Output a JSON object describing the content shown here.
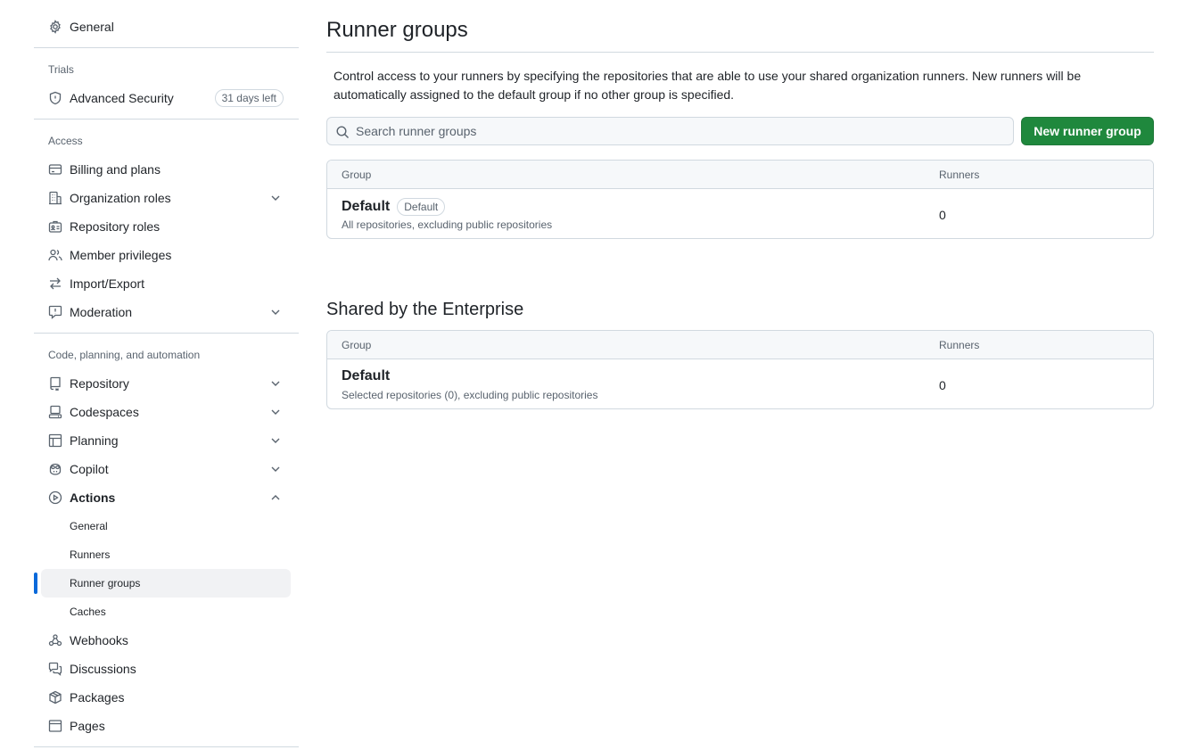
{
  "sidebar": {
    "general": "General",
    "trials_label": "Trials",
    "advanced_security": "Advanced Security",
    "trial_badge": "31 days left",
    "access_label": "Access",
    "access_items": [
      {
        "label": "Billing and plans",
        "icon": "credit-card-icon"
      },
      {
        "label": "Organization roles",
        "icon": "organization-icon",
        "expandable": true
      },
      {
        "label": "Repository roles",
        "icon": "id-badge-icon"
      },
      {
        "label": "Member privileges",
        "icon": "people-icon"
      },
      {
        "label": "Import/Export",
        "icon": "arrow-switch-icon"
      },
      {
        "label": "Moderation",
        "icon": "report-icon",
        "expandable": true
      }
    ],
    "code_label": "Code, planning, and automation",
    "code_items": [
      {
        "label": "Repository",
        "icon": "repo-icon",
        "expandable": true
      },
      {
        "label": "Codespaces",
        "icon": "codespaces-icon",
        "expandable": true
      },
      {
        "label": "Planning",
        "icon": "table-icon",
        "expandable": true
      },
      {
        "label": "Copilot",
        "icon": "copilot-icon",
        "expandable": true
      },
      {
        "label": "Actions",
        "icon": "play-icon",
        "expanded": true
      }
    ],
    "actions_sub": [
      "General",
      "Runners",
      "Runner groups",
      "Caches"
    ],
    "active_sub": "Runner groups",
    "more_items": [
      {
        "label": "Webhooks",
        "icon": "webhook-icon"
      },
      {
        "label": "Discussions",
        "icon": "comment-discussion-icon"
      },
      {
        "label": "Packages",
        "icon": "package-icon"
      },
      {
        "label": "Pages",
        "icon": "browser-icon"
      }
    ]
  },
  "main": {
    "title": "Runner groups",
    "description": "Control access to your runners by specifying the repositories that are able to use your shared organization runners. New runners will be automatically assigned to the default group if no other group is specified.",
    "search_placeholder": "Search runner groups",
    "new_button": "New runner group",
    "table": {
      "col_group": "Group",
      "col_runners": "Runners",
      "rows": [
        {
          "name": "Default",
          "badge": "Default",
          "sub": "All repositories, excluding public repositories",
          "runners": "0"
        }
      ]
    },
    "shared_title": "Shared by the Enterprise",
    "shared_table": {
      "col_group": "Group",
      "col_runners": "Runners",
      "rows": [
        {
          "name": "Default",
          "sub": "Selected repositories (0), excluding public repositories",
          "runners": "0"
        }
      ]
    }
  },
  "colors": {
    "accent": "#0969da",
    "primary_button": "#1f883d",
    "border": "#d1d9e0",
    "muted_text": "#59636e"
  }
}
